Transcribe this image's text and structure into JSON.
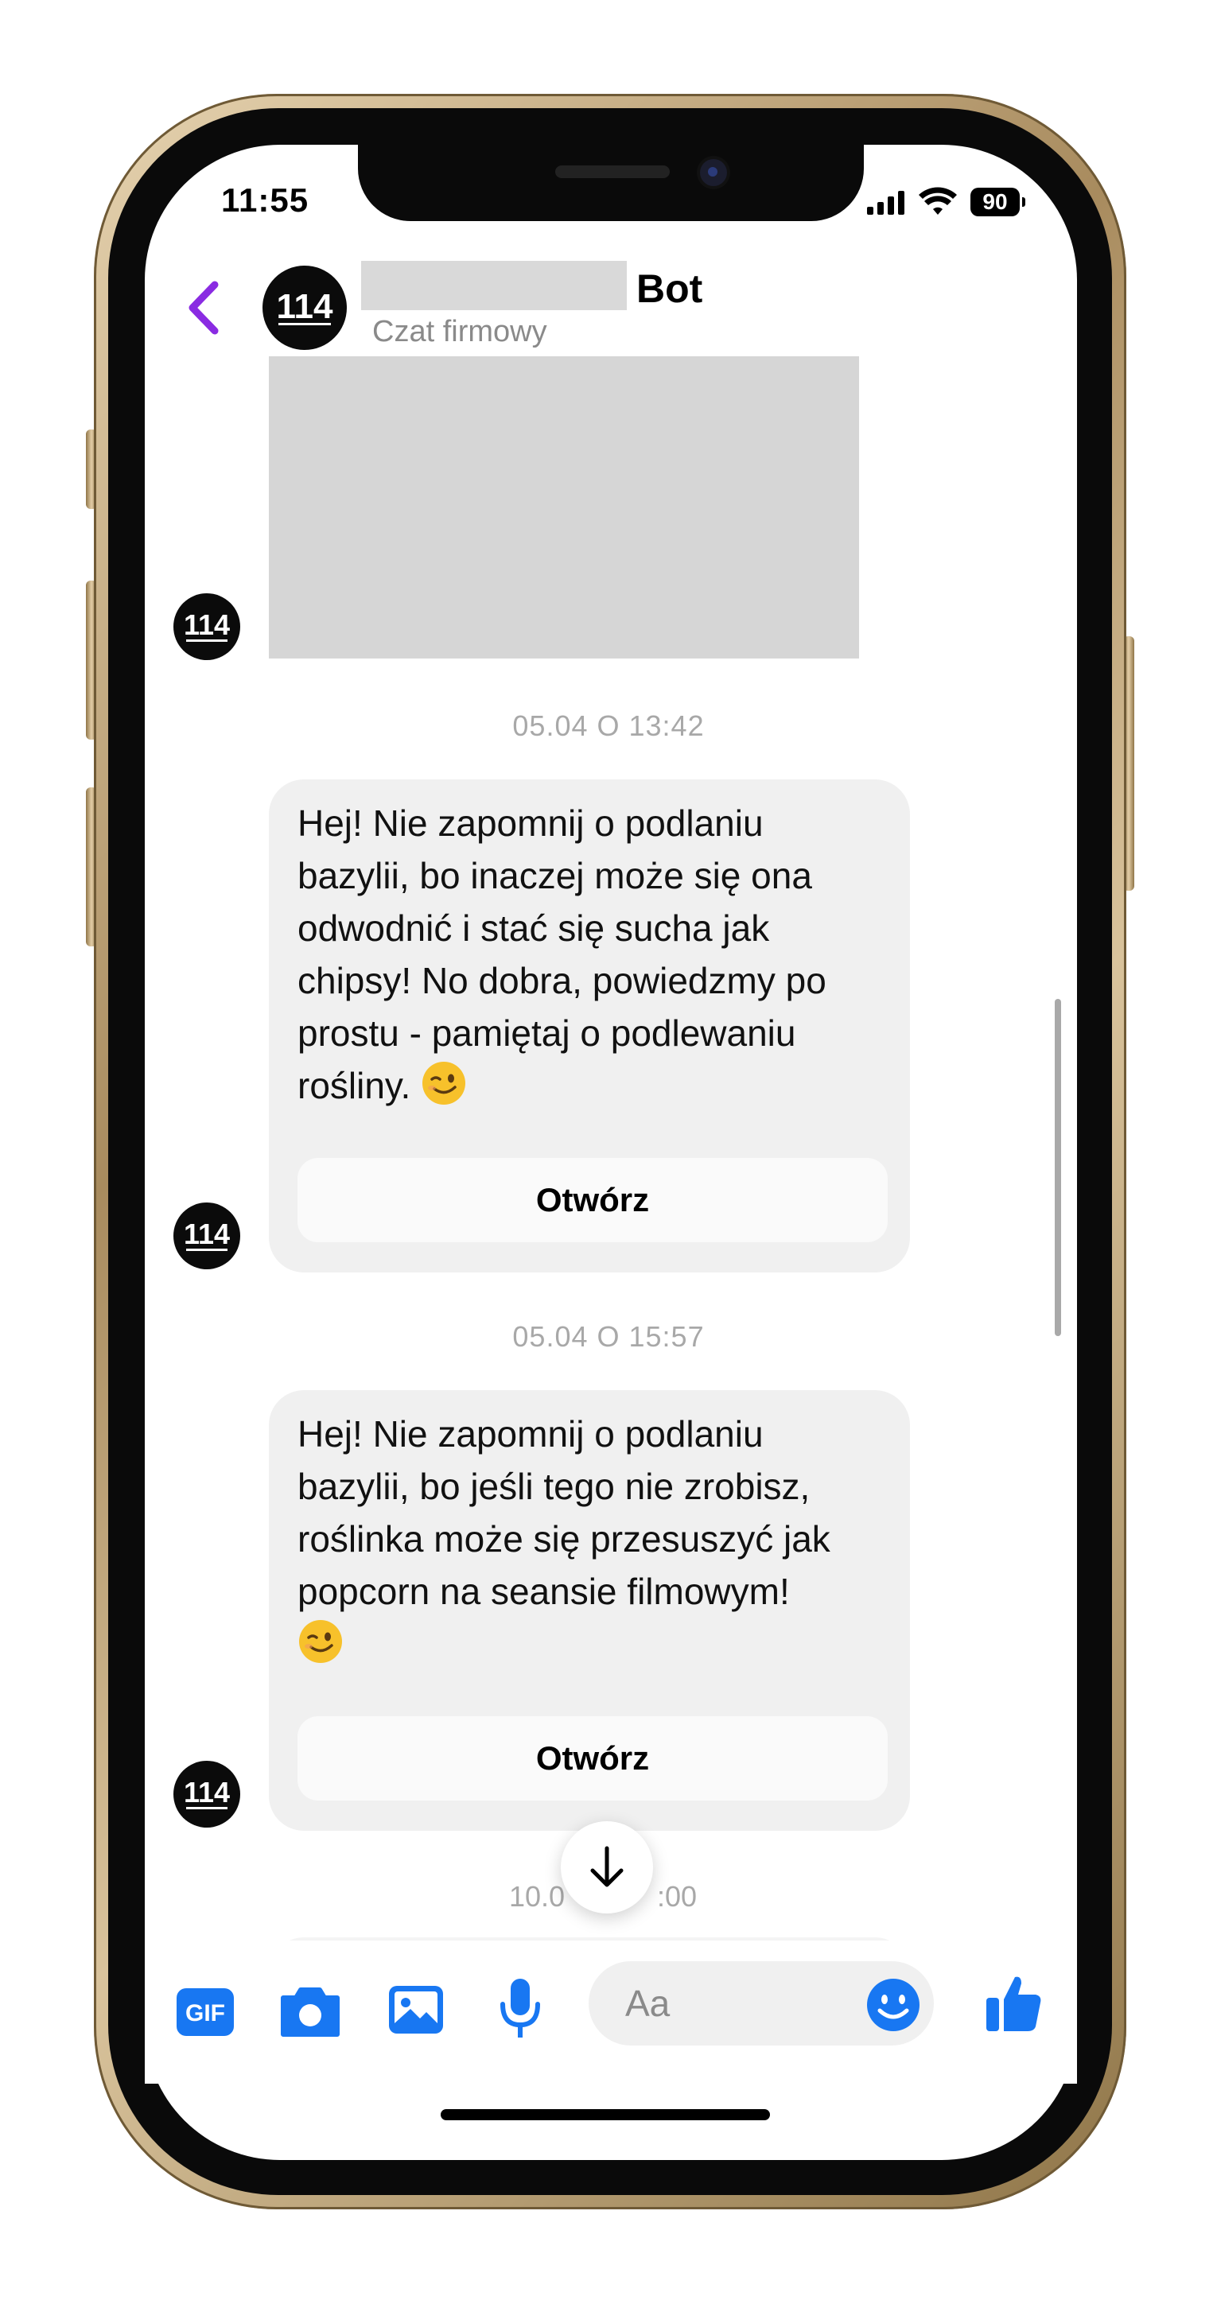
{
  "status_bar": {
    "time": "11:55",
    "battery": "90"
  },
  "header": {
    "avatar_text": "114",
    "name_suffix": "Bot",
    "subtitle": "Czat firmowy"
  },
  "messages": [
    {
      "timestamp": "05.04 O 13:42",
      "text": "Hej! Nie zapomnij o podlaniu\nbazylii, bo inaczej może się ona\nodwodnić i stać się sucha jak\nchipsy! No dobra, powiedzmy po\nprostu - pamiętaj o podlewaniu\nrośliny. ",
      "button": "Otwórz",
      "emoji": "winking-face"
    },
    {
      "timestamp": "05.04 O 15:57",
      "text": "Hej! Nie zapomnij o podlaniu\nbazylii, bo jeśli tego nie zrobisz,\nroślinka może się przesuszyć jak\npopcorn na seansie filmowym!\n",
      "button": "Otwórz",
      "emoji": "winking-face"
    }
  ],
  "partial_timestamp": {
    "left": "10.0",
    "right": ":00"
  },
  "composer": {
    "placeholder": "Aa",
    "icons": [
      "gif-icon",
      "camera-icon",
      "image-icon",
      "microphone-icon",
      "emoji-icon",
      "thumbs-up-icon"
    ]
  },
  "colors": {
    "accent": "#1877f2",
    "back": "#8a2be2",
    "bubble": "#f0f0f0"
  }
}
